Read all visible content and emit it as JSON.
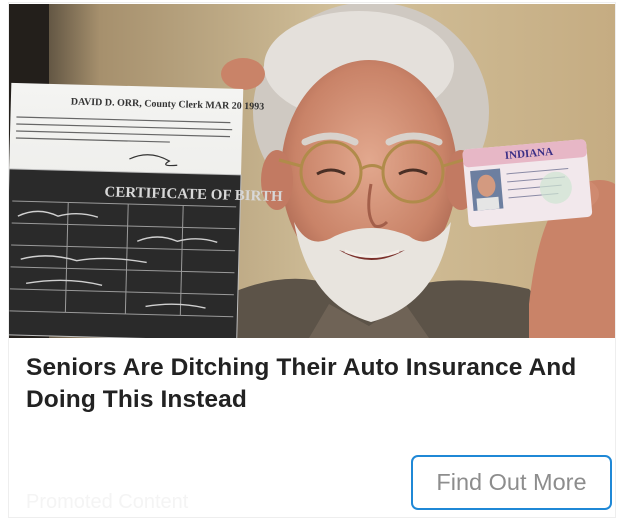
{
  "ad": {
    "headline": "Seniors Are Ditching Their Auto Insurance And Doing This Instead",
    "promoted_label": "Promoted Content",
    "cta_label": "Find Out More"
  },
  "image": {
    "subject": "older man holding birth certificate and ID card",
    "certificate_title": "CERTIFICATE OF BIRTH",
    "certificate_header": "DAVID D. ORR, County Clerk MAR 20 1993",
    "id_card_state": "INDIANA"
  },
  "colors": {
    "headline": "#222222",
    "button_border": "#1f88d6",
    "button_text": "#8d8d8d",
    "promoted_text": "#f4f4f4"
  }
}
